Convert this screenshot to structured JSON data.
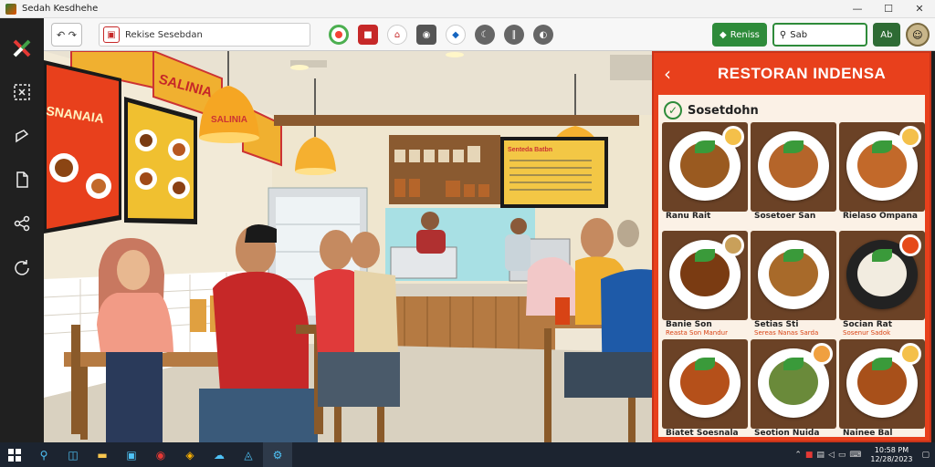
{
  "window": {
    "title": "Sedah Kesdhehe",
    "controls": [
      "—",
      "☐",
      "✕"
    ]
  },
  "sidebar": {
    "items": [
      "x-icon",
      "select-icon",
      "share-icon",
      "document-icon",
      "network-icon",
      "refresh-icon"
    ]
  },
  "toolbar": {
    "back_label": "↶ ↷",
    "address": "Rekise Sesebdan",
    "center_icons": [
      "chrome-icon",
      "stop-icon",
      "home-icon",
      "camera-icon",
      "globe-icon",
      "moon-icon",
      "pause-icon",
      "shield-icon"
    ],
    "green_button": "Reniss",
    "search_value": "Sab",
    "dark_button": "Ab"
  },
  "panel": {
    "title": "RESTORAN INDENSA",
    "section_title": "Sosetdohn",
    "cards": [
      {
        "caption": "Ranu Rait",
        "sub": ""
      },
      {
        "caption": "Sosetoer San",
        "sub": ""
      },
      {
        "caption": "Rielaso Ompana",
        "sub": ""
      },
      {
        "caption": "Banie Son",
        "sub": "Reasta Son Mandur"
      },
      {
        "caption": "Setias Sti",
        "sub": "Sereas Nanas Sarda"
      },
      {
        "caption": "Socian Rat",
        "sub": "Sosenur Sadok"
      },
      {
        "caption": "Biatet Soesnala",
        "sub": ""
      },
      {
        "caption": "Seotion Nuida",
        "sub": ""
      },
      {
        "caption": "Nainee Bal",
        "sub": ""
      }
    ]
  },
  "scene": {
    "wall_sign_top": "SALINIA",
    "wall_sign_left": "SNANAIA",
    "wall_sign_lamp": "SALINIA",
    "menu_board_title": "Senteda Batbn"
  },
  "taskbar": {
    "apps": [
      "windows-icon",
      "search-icon",
      "task-view-icon",
      "folder-icon",
      "store-icon",
      "chrome-icon",
      "app-icon",
      "cloud-icon",
      "edge-icon",
      "settings-icon"
    ],
    "clock_time": "10:58 PM",
    "clock_date": "12/28/2023"
  }
}
